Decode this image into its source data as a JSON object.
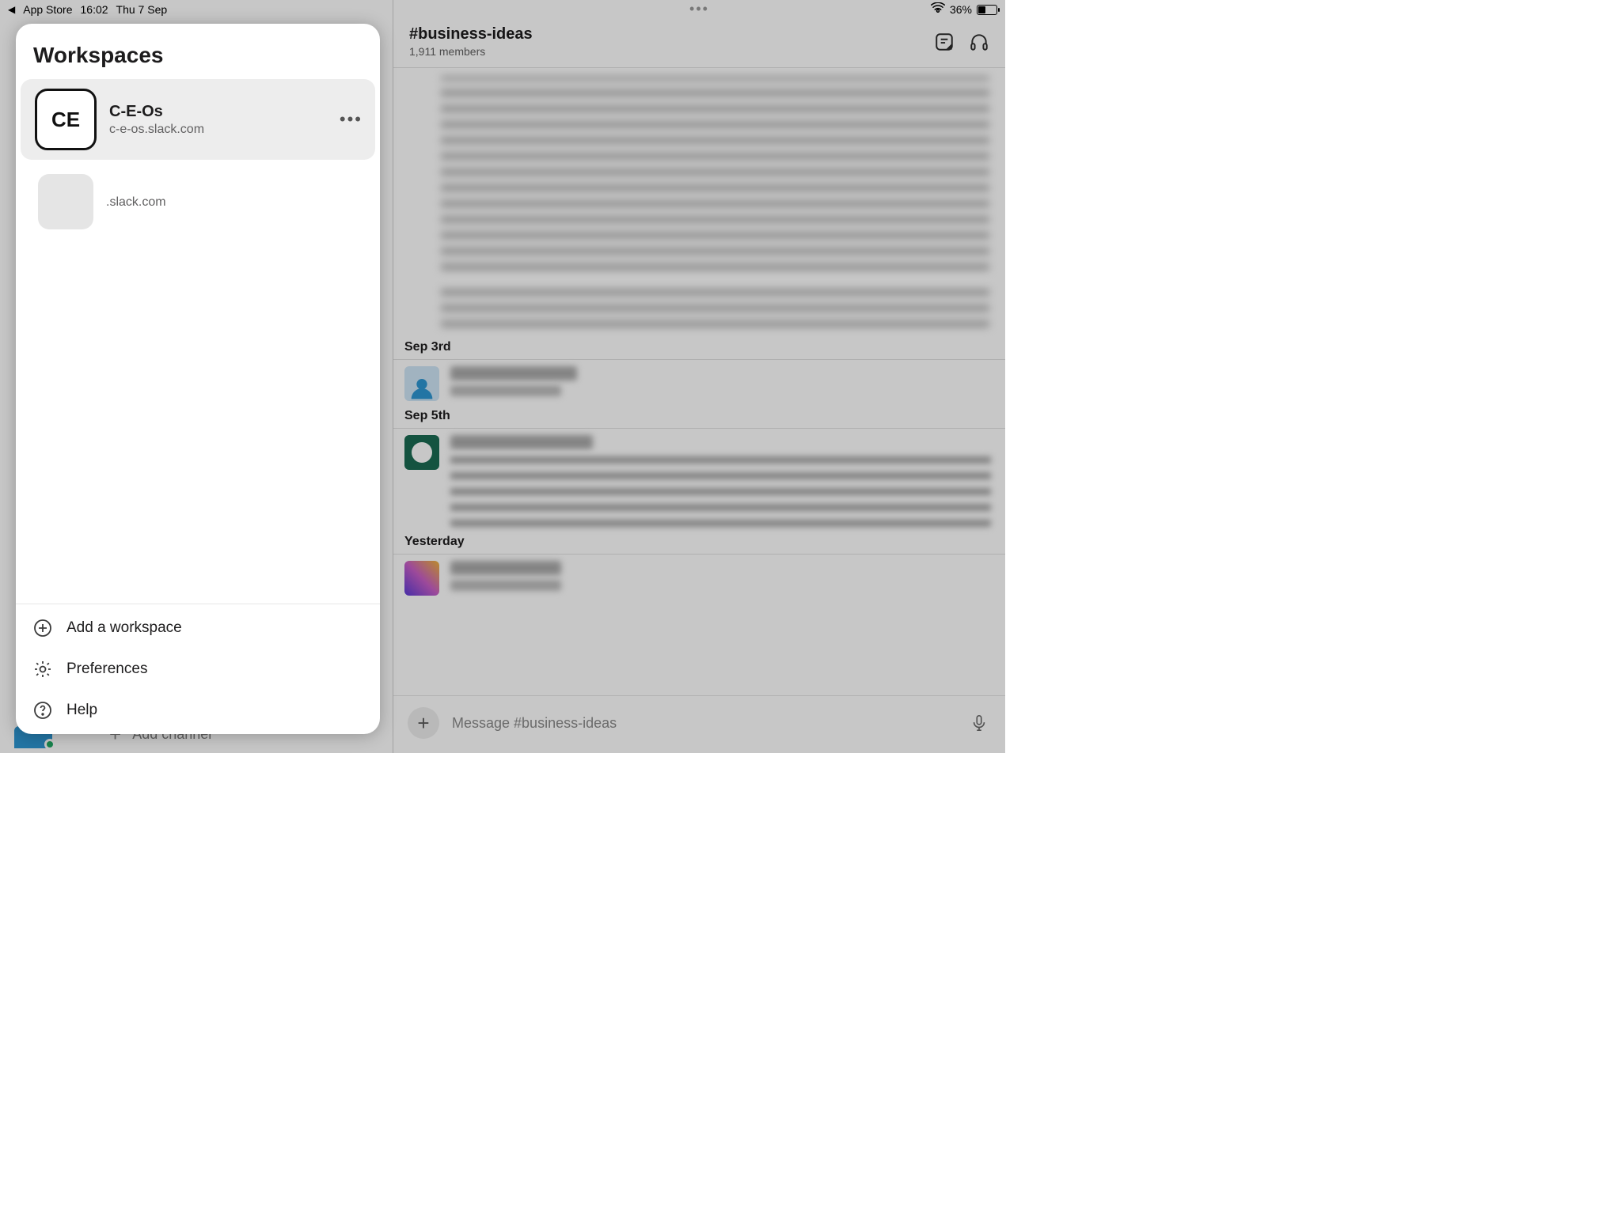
{
  "status": {
    "back_app": "App Store",
    "time": "16:02",
    "date": "Thu 7 Sep",
    "battery_pct": "36%"
  },
  "channel": {
    "name": "#business-ideas",
    "members": "1,911 members"
  },
  "dividers": [
    "Sep 3rd",
    "Sep 5th",
    "Yesterday"
  ],
  "composer": {
    "placeholder": "Message #business-ideas"
  },
  "left_bottom": {
    "add_channel": "Add channel"
  },
  "sheet": {
    "title": "Workspaces",
    "workspaces": [
      {
        "abbr": "CE",
        "name": "C-E-Os",
        "url": "c-e-os.slack.com"
      },
      {
        "abbr": "",
        "name": "",
        "url": ".slack.com"
      }
    ],
    "footer": {
      "add": "Add a workspace",
      "prefs": "Preferences",
      "help": "Help"
    }
  }
}
